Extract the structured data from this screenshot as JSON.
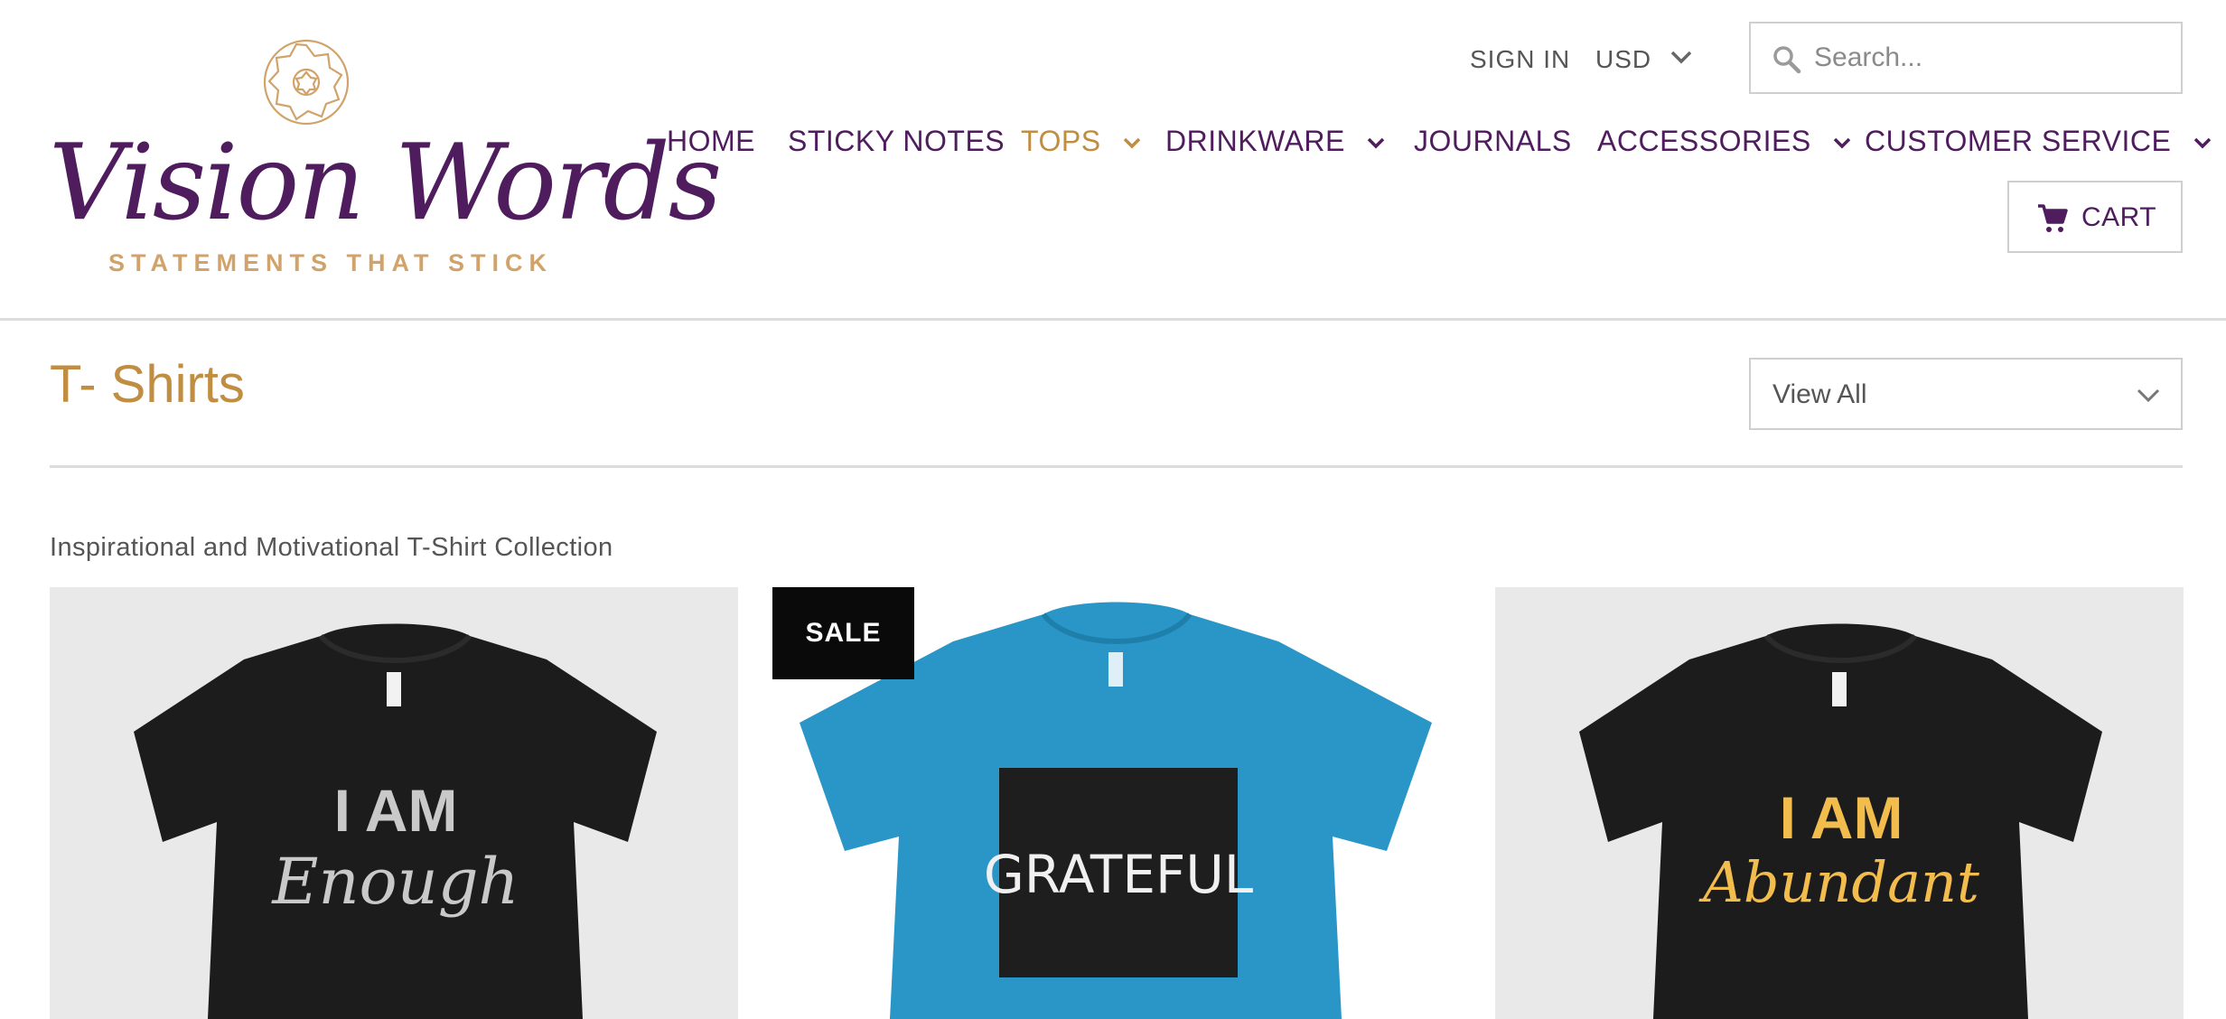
{
  "header": {
    "logo": {
      "script": "Vision Words",
      "tagline": "STATEMENTS THAT STICK"
    },
    "sign_in": "SIGN IN",
    "currency": "USD",
    "search": {
      "placeholder": "Search..."
    },
    "nav": [
      {
        "label": "HOME",
        "dropdown": false
      },
      {
        "label": "STICKY NOTES",
        "dropdown": false
      },
      {
        "label": "TOPS",
        "dropdown": true,
        "active": true
      },
      {
        "label": "DRINKWARE",
        "dropdown": true
      },
      {
        "label": "JOURNALS",
        "dropdown": false
      },
      {
        "label": "ACCESSORIES",
        "dropdown": true
      },
      {
        "label": "CUSTOMER SERVICE",
        "dropdown": true
      }
    ],
    "cart": "CART"
  },
  "page": {
    "title": "T- Shirts",
    "view_select": "View All",
    "description": "Inspirational and Motivational T-Shirt Collection"
  },
  "products": [
    {
      "shirt_line1": "I AM",
      "shirt_line2": "Enough",
      "shirt_color": "#1c1c1c",
      "text_color": "#c9c9c9"
    },
    {
      "badge": "SALE",
      "shirt_line1": "GRATEFUL",
      "shirt_color": "#2a96c8",
      "text_color": "#f0f0f0"
    },
    {
      "shirt_line1": "I AM",
      "shirt_line2": "Abundant",
      "shirt_color": "#1c1c1c",
      "text_color": "#f3bd4e"
    }
  ],
  "colors": {
    "brand_purple": "#4f1c5e",
    "brand_gold": "#c08d41"
  }
}
